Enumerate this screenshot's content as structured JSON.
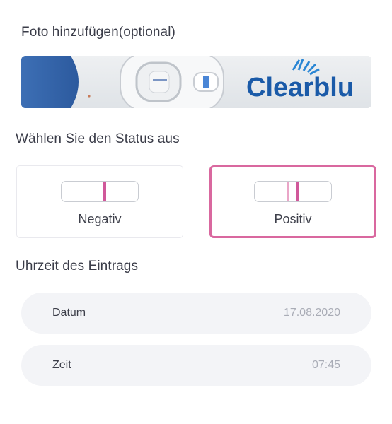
{
  "photo_section": {
    "title": "Foto hinzufügen(optional)",
    "photo_brand_text": "Clearblu"
  },
  "status_section": {
    "title": "Wählen Sie den Status aus",
    "options": [
      {
        "label": "Negativ",
        "selected": false
      },
      {
        "label": "Positiv",
        "selected": true
      }
    ]
  },
  "time_section": {
    "title": "Uhrzeit des Eintrags",
    "date_label": "Datum",
    "date_value": "17.08.2020",
    "time_label": "Zeit",
    "time_value": "07:45"
  },
  "colors": {
    "accent": "#d9689f",
    "test_line": "#d0589a",
    "test_line_faint": "#eaa6c8",
    "row_bg": "#f3f4f7",
    "placeholder_value": "#a9acb6",
    "brand_blue": "#1a5aa8"
  }
}
